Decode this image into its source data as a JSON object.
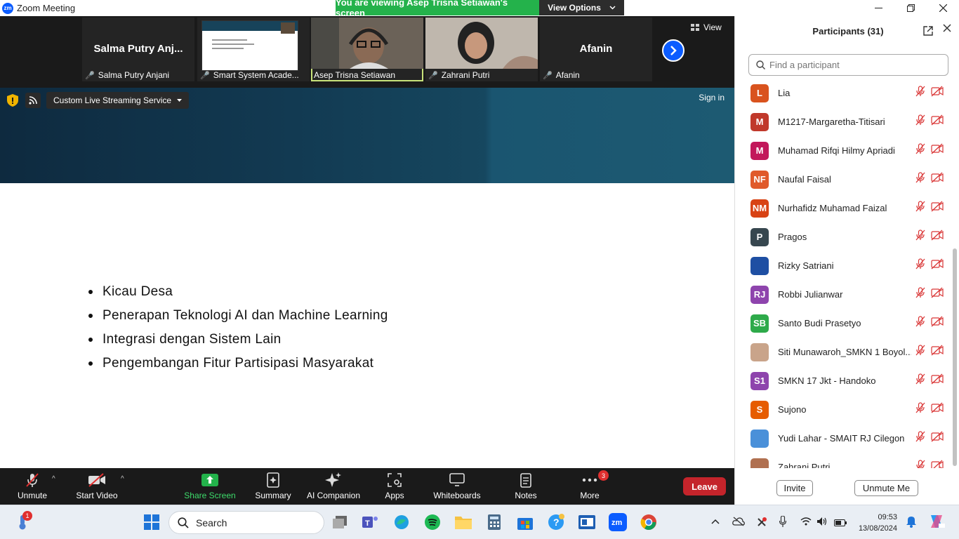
{
  "app": {
    "title": "Zoom Meeting",
    "logo": "zm"
  },
  "banner": {
    "viewing": "You are viewing Asep Trisna Setiawan's screen",
    "view_options": "View Options"
  },
  "strip": {
    "view_label": "View",
    "tiles": [
      {
        "display": "Salma Putry Anj...",
        "label": "Salma Putry Anjani"
      },
      {
        "label": "Smart System Acade..."
      },
      {
        "label": "Asep Trisna Setiawan"
      },
      {
        "label": "Zahrani Putri"
      },
      {
        "display": "Afanin",
        "label": "Afanin"
      }
    ]
  },
  "content": {
    "stream_label": "Custom Live Streaming Service",
    "signin": "Sign in",
    "bullets": [
      "Kicau Desa",
      "Penerapan Teknologi AI dan Machine Learning",
      "Integrasi dengan Sistem Lain",
      "Pengembangan Fitur Partisipasi Masyarakat"
    ]
  },
  "toolbar": {
    "unmute": "Unmute",
    "start_video": "Start Video",
    "share_screen": "Share Screen",
    "summary": "Summary",
    "ai_companion": "AI Companion",
    "apps": "Apps",
    "whiteboards": "Whiteboards",
    "notes": "Notes",
    "more": "More",
    "more_badge": "3",
    "leave": "Leave"
  },
  "participants": {
    "title": "Participants (31)",
    "search_placeholder": "Find a participant",
    "invite": "Invite",
    "unmute_me": "Unmute Me",
    "list": [
      {
        "initials": "L",
        "name": "Lia",
        "color": "#d9531e"
      },
      {
        "initials": "M",
        "name": "M1217-Margaretha-Titisari",
        "color": "#c0392b"
      },
      {
        "initials": "M",
        "name": "Muhamad Rifqi Hilmy Apriadi",
        "color": "#c2185b"
      },
      {
        "initials": "NF",
        "name": "Naufal Faisal",
        "color": "#e05a2b"
      },
      {
        "initials": "NM",
        "name": "Nurhafidz Muhamad Faizal",
        "color": "#d84315"
      },
      {
        "initials": "P",
        "name": "Pragos",
        "color": "#37474f"
      },
      {
        "initials": "",
        "name": "Rizky Satriani",
        "color": "#1e4fa3"
      },
      {
        "initials": "RJ",
        "name": "Robbi Julianwar",
        "color": "#8e44ad"
      },
      {
        "initials": "SB",
        "name": "Santo Budi Prasetyo",
        "color": "#2eaa4a"
      },
      {
        "initials": "",
        "name": "Siti Munawaroh_SMKN 1 Boyol...",
        "color": "#c9a48a"
      },
      {
        "initials": "S1",
        "name": "SMKN 17 Jkt - Handoko",
        "color": "#8e44ad"
      },
      {
        "initials": "S",
        "name": "Sujono",
        "color": "#e65c00"
      },
      {
        "initials": "",
        "name": "Yudi Lahar - SMAIT RJ Cilegon",
        "color": "#4a90d9"
      },
      {
        "initials": "",
        "name": "Zahrani Putri",
        "color": "#b07050"
      }
    ]
  },
  "taskbar": {
    "search": "Search",
    "time": "09:53",
    "date": "13/08/2024",
    "notification_badge": "1"
  }
}
